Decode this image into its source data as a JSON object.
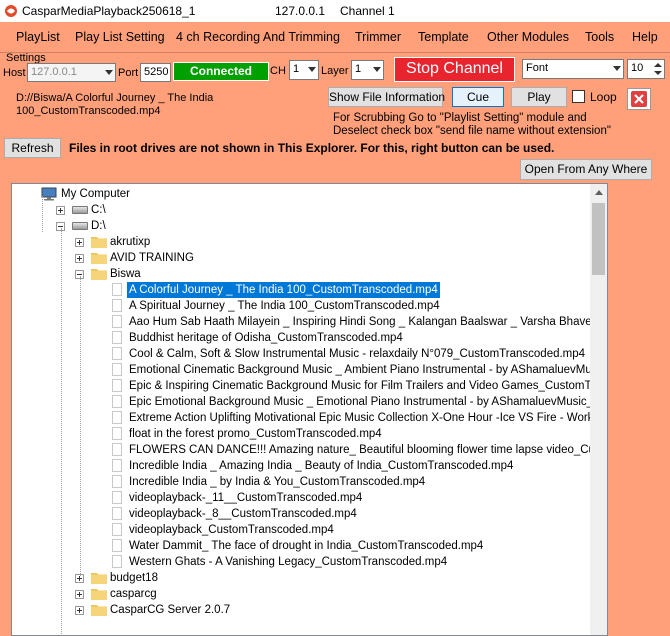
{
  "window": {
    "app_title": "CasparMediaPlayback250618_1",
    "server_ip": "127.0.0.1",
    "channel": "Channel 1"
  },
  "menu": [
    "PlayList",
    "Play List Setting",
    "4 ch Recording And Trimming",
    "Trimmer",
    "Template",
    "Other Modules",
    "Tools",
    "Help"
  ],
  "settings": {
    "group_label": "Settings",
    "host_label": "Host",
    "host_value": "127.0.0.1",
    "port_label": "Port",
    "port_value": "5250",
    "status": "Connected",
    "ch_label": "CH",
    "ch_value": "1",
    "layer_label": "Layer",
    "layer_value": "1",
    "stop_channel": "Stop Channel",
    "font_value": "Font",
    "font_size": "10"
  },
  "file_bar": {
    "path_line1": "D://Biswa/A Colorful Journey _ The India",
    "path_line2": "100_CustomTranscoded.mp4",
    "show_info": "Show File Information",
    "cue": "Cue",
    "play": "Play",
    "loop": "Loop",
    "loop_checked": false,
    "hint_line1": "For Scrubbing Go to \"Playlist Setting\" module and",
    "hint_line2": "Deselect check box \"send file name without extension\""
  },
  "refresh_button": "Refresh",
  "root_note": "Files in root drives are not shown in This Explorer.  For this, right button can be used.",
  "open_any_where": "Open From Any Where",
  "tree": {
    "root": "My Computer",
    "drives": [
      "C:\\",
      "D:\\"
    ],
    "folders_before": [
      "akrutixp",
      "AVID TRAINING",
      "Biswa"
    ],
    "biswa_files": [
      "A Colorful Journey _ The India 100_CustomTranscoded.mp4",
      "A Spiritual Journey _ The India 100_CustomTranscoded.mp4",
      "Aao Hum Sab Haath Milayein _ Inspiring Hindi Song _ Kalangan Baalswar _ Varsha Bhave_CustomTr",
      "Buddhist heritage of Odisha_CustomTranscoded.mp4",
      "Cool & Calm, Soft & Slow Instrumental Music - relaxdaily N°079_CustomTranscoded.mp4",
      "Emotional Cinematic Background Music _ Ambient Piano Instrumental - by AShamaluevMusic_Custom",
      "Epic & Inspiring Cinematic Background Music for Film Trailers and Video Games_CustomTranscoded.n",
      "Epic Emotional Background Music _ Emotional Piano Instrumental - by AShamaluevMusic_CustomTra",
      "Extreme Action Uplifting Motivational Epic Music Collection X-One Hour -Ice VS Fire - Workout-Gaming",
      "float in the forest promo_CustomTranscoded.mp4",
      "FLOWERS CAN DANCE!!! Amazing nature_ Beautiful blooming flower time lapse video_CustomTrans",
      "Incredible India _ Amazing India _ Beauty of India_CustomTranscoded.mp4",
      "Incredible India _ by India & You_CustomTranscoded.mp4",
      "videoplayback-_11__CustomTranscoded.mp4",
      "videoplayback-_8__CustomTranscoded.mp4",
      "videoplayback_CustomTranscoded.mp4",
      "Water Dammit_ The face of drought in India_CustomTranscoded.mp4",
      "Western Ghats - A Vanishing Legacy_CustomTranscoded.mp4"
    ],
    "folders_after": [
      "budget18",
      "casparcg",
      "CasparCG Server 2.0.7"
    ],
    "selected_index": 0
  },
  "colors": {
    "background": "#ffa07a",
    "status_green": "#00a000",
    "stop_red": "#e8242f",
    "close_red": "#e04040",
    "selection": "#0078d7"
  }
}
